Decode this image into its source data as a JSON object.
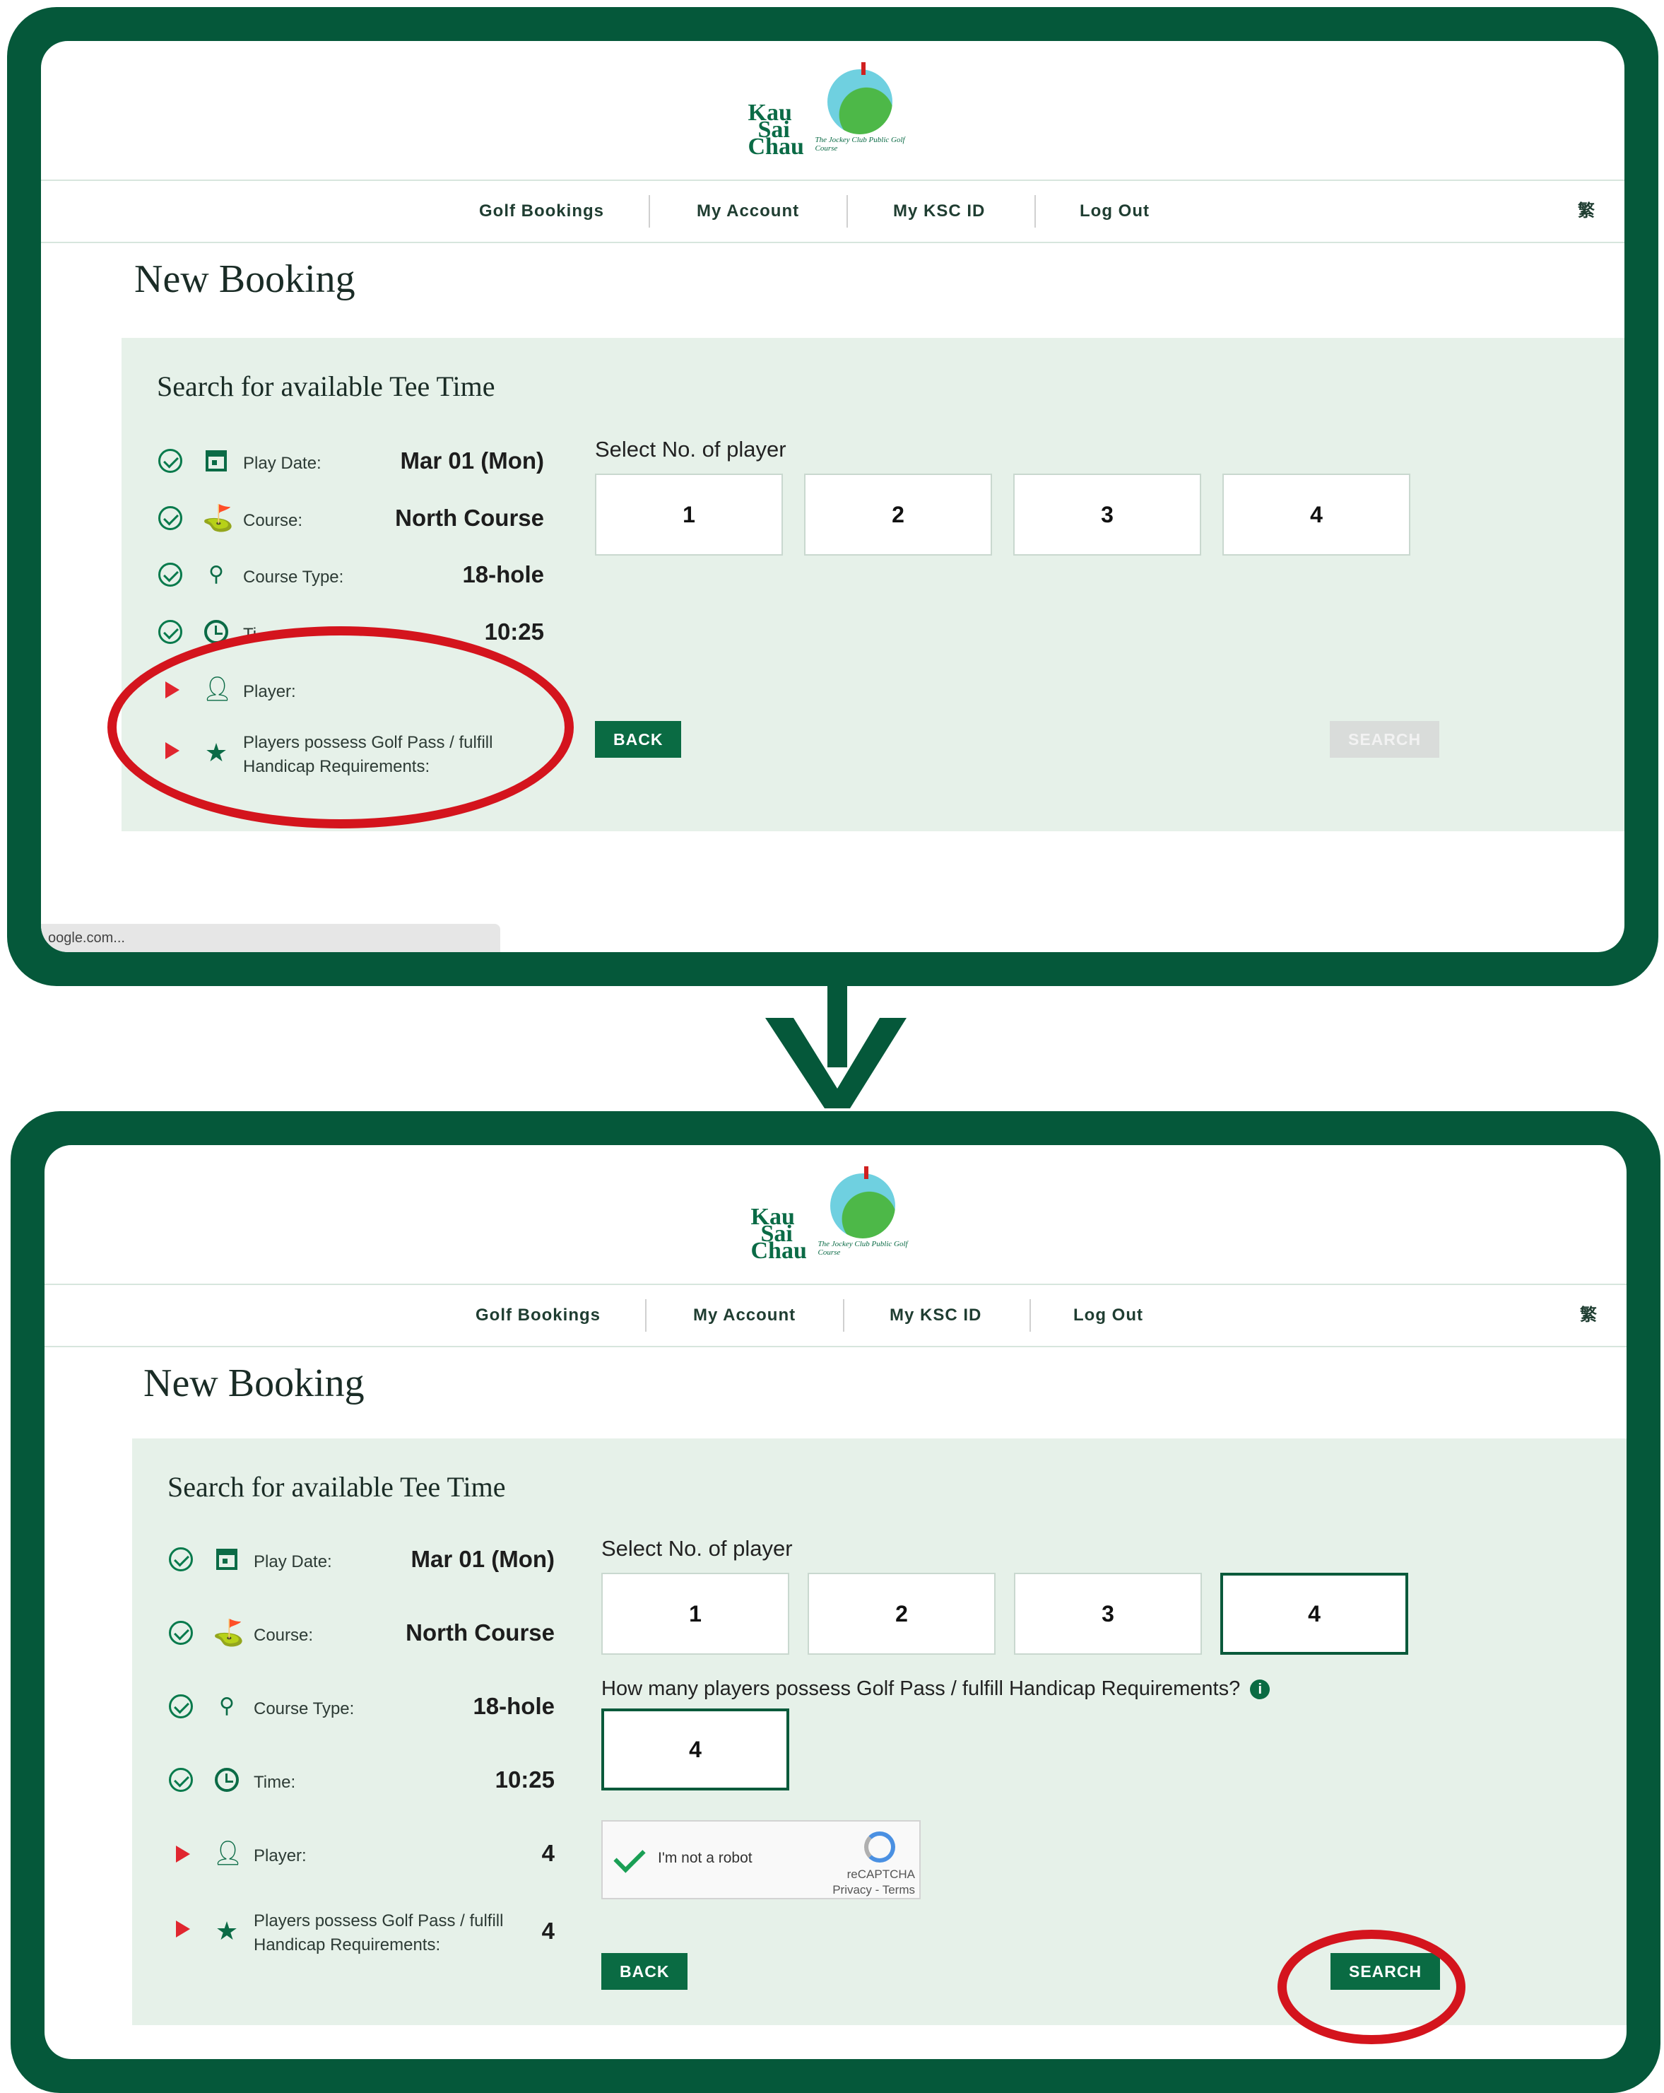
{
  "header": {
    "logo_text_kau": "Kau",
    "logo_text_sai": "Sai",
    "logo_text_chau": "Chau",
    "logo_subtitle": "The Jockey Club Public Golf Course",
    "nav": [
      "Golf Bookings",
      "My Account",
      "My KSC ID",
      "Log Out"
    ],
    "lang_toggle": "繁"
  },
  "page_title": "New Booking",
  "panel_title": "Search for available Tee Time",
  "labels": {
    "play_date": "Play Date:",
    "course": "Course:",
    "course_type": "Course Type:",
    "time": "Time:",
    "player": "Player:",
    "golf_pass": "Players possess Golf Pass / fulfill Handicap Requirements:"
  },
  "values": {
    "play_date": "Mar 01 (Mon)",
    "course": "North Course",
    "course_type": "18-hole",
    "time": "10:25"
  },
  "select_label": "Select No. of player",
  "player_options": [
    "1",
    "2",
    "3",
    "4"
  ],
  "buttons": {
    "back": "BACK",
    "search": "SEARCH"
  },
  "top_state": {
    "time_label_partial": "Ti",
    "search_enabled": false,
    "status_url": "oogle.com..."
  },
  "bottom_state": {
    "selected_players": "4",
    "player_value": "4",
    "golf_pass_value": "4",
    "question": "How many players possess Golf Pass / fulfill Handicap Requirements?",
    "info_icon": "i",
    "golf_pass_selected": "4",
    "captcha_text": "I'm not a robot",
    "captcha_brand": "reCAPTCHA",
    "captcha_links": "Privacy - Terms",
    "search_enabled": true
  },
  "colors": {
    "frame": "#05583a",
    "panel": "#e6f1e9",
    "primary_button": "#0a6b43",
    "highlight_circle": "#d4141d",
    "arrow_icon": "#e0262f"
  }
}
